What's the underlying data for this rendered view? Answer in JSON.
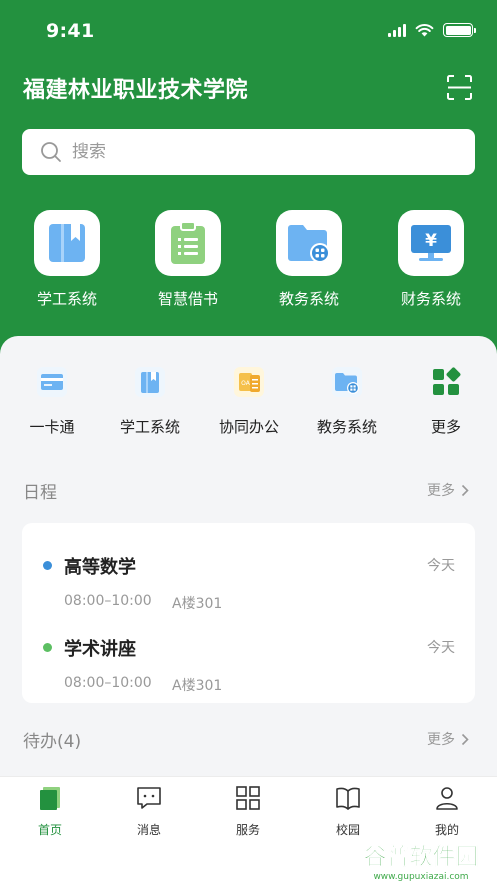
{
  "status_bar": {
    "time": "9:41"
  },
  "header": {
    "title": "福建林业职业技术学院"
  },
  "search": {
    "placeholder": "搜索"
  },
  "top_apps": [
    {
      "label": "学工系统",
      "icon": "bookmark-book-icon"
    },
    {
      "label": "智慧借书",
      "icon": "clipboard-list-icon"
    },
    {
      "label": "教务系统",
      "icon": "folder-grid-icon"
    },
    {
      "label": "财务系统",
      "icon": "yuan-monitor-icon"
    }
  ],
  "quick_apps": [
    {
      "label": "一卡通",
      "icon": "card-icon"
    },
    {
      "label": "学工系统",
      "icon": "bookmark-book-icon"
    },
    {
      "label": "协同办公",
      "icon": "oa-document-icon"
    },
    {
      "label": "教务系统",
      "icon": "folder-grid-icon"
    },
    {
      "label": "更多",
      "icon": "apps-grid-icon"
    }
  ],
  "schedule": {
    "title": "日程",
    "more": "更多",
    "items": [
      {
        "title": "高等数学",
        "day": "今天",
        "time": "08:00–10:00",
        "location": "A楼301",
        "dot_color": "#3b8fd9"
      },
      {
        "title": "学术讲座",
        "day": "今天",
        "time": "08:00–10:00",
        "location": "A楼301",
        "dot_color": "#5cbf62"
      }
    ]
  },
  "todo": {
    "title": "待办(4)",
    "more": "更多"
  },
  "tabbar": [
    {
      "label": "首页",
      "icon": "home-icon",
      "active": true
    },
    {
      "label": "消息",
      "icon": "message-icon",
      "active": false
    },
    {
      "label": "服务",
      "icon": "grid-services-icon",
      "active": false
    },
    {
      "label": "校园",
      "icon": "open-book-icon",
      "active": false
    },
    {
      "label": "我的",
      "icon": "user-icon",
      "active": false
    }
  ],
  "watermark": {
    "text": "谷普软件园",
    "url": "www.gupuxiazai.com"
  },
  "colors": {
    "brand_green": "#23913f",
    "light_blue": "#6db3f2",
    "light_green": "#8fd17f"
  }
}
